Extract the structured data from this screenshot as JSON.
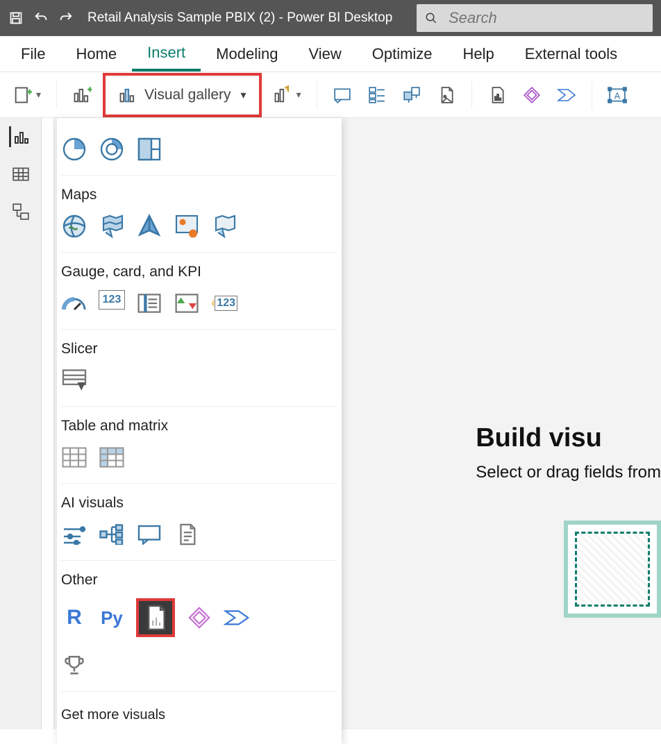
{
  "titlebar": {
    "title": "Retail Analysis Sample PBIX (2) - Power BI Desktop",
    "search_placeholder": "Search"
  },
  "menubar": {
    "items": [
      "File",
      "Home",
      "Insert",
      "Modeling",
      "View",
      "Optimize",
      "Help",
      "External tools"
    ],
    "active": "Insert"
  },
  "toolbar": {
    "visual_gallery_label": "Visual gallery"
  },
  "gallery": {
    "sections": {
      "maps": "Maps",
      "gauge": "Gauge, card, and KPI",
      "slicer": "Slicer",
      "table": "Table and matrix",
      "ai": "AI visuals",
      "other": "Other"
    },
    "other_r": "R",
    "other_py": "Py",
    "numeric_card": "123",
    "kpi_new_card": "123",
    "get_more": "Get more visuals"
  },
  "canvas": {
    "heading": "Build visu",
    "subtext": "Select or drag fields from"
  }
}
